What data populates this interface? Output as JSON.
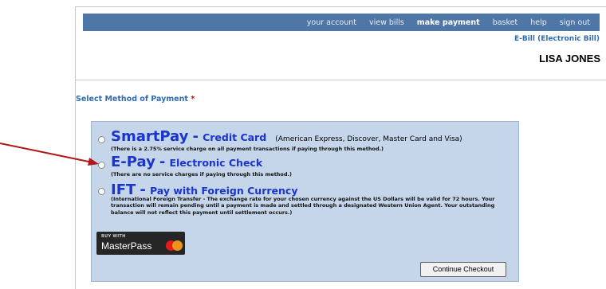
{
  "nav": {
    "items": [
      {
        "label": "your account",
        "active": false
      },
      {
        "label": "view bills",
        "active": false
      },
      {
        "label": "make payment",
        "active": true
      },
      {
        "label": "basket",
        "active": false
      },
      {
        "label": "help",
        "active": false
      },
      {
        "label": "sign out",
        "active": false
      }
    ],
    "bar_color": "#4e76a7"
  },
  "header": {
    "bill_type": "E-Bill (Electronic Bill)",
    "user_name": "LISA JONES"
  },
  "payment": {
    "section_title": "Select Method of Payment",
    "required_marker": "*",
    "options": [
      {
        "name": "SmartPay",
        "separator": "-",
        "subtitle": "Credit Card",
        "parenthetical": "(American Express, Discover, Master Card and Visa)",
        "note": "(There is a 2.75% service charge on all payment transactions if paying through this method.)"
      },
      {
        "name": "E-Pay",
        "separator": "-",
        "subtitle": "Electronic Check",
        "parenthetical": "",
        "note": "(There are no service charges if paying through this method.)"
      },
      {
        "name": "IFT",
        "separator": "-",
        "subtitle": "Pay with Foreign Currency",
        "parenthetical": "",
        "note": "(International Foreign Transfer - The exchange rate for your chosen currency against the US Dollars will be valid for 72 hours. Your transaction will remain pending until a payment is made and settled through a designated Western Union Agent. Your outstanding balance will not reflect this payment until settlement occurs.)"
      }
    ],
    "masterpass": {
      "small_text": "BUY WITH",
      "brand": "MasterPass"
    },
    "continue_label": "Continue Checkout",
    "panel_color": "#c6d6ea",
    "option_color": "#1a35c9"
  },
  "annotation": {
    "arrow_color": "#b01818"
  }
}
